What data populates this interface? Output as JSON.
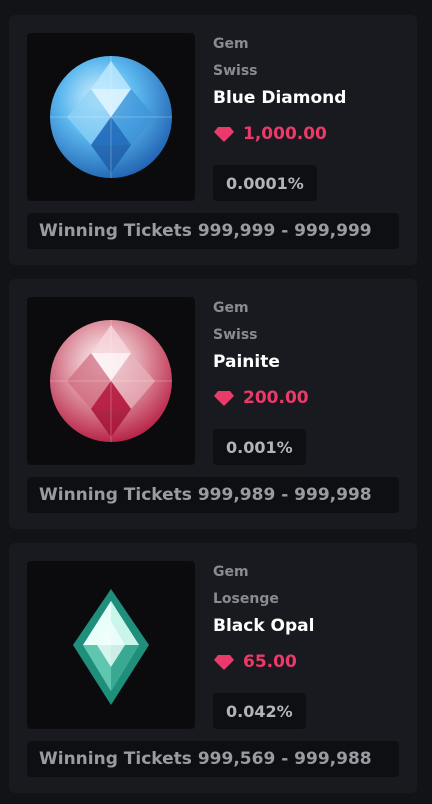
{
  "prizes": [
    {
      "type": "Gem",
      "cut": "Swiss",
      "name": "Blue Diamond",
      "price": "1,000.00",
      "chance": "0.0001%",
      "tickets": "Winning Tickets 999,999 - 999,999",
      "icon": "blue-diamond-gem-icon"
    },
    {
      "type": "Gem",
      "cut": "Swiss",
      "name": "Painite",
      "price": "200.00",
      "chance": "0.001%",
      "tickets": "Winning Tickets 999,989 - 999,998",
      "icon": "painite-gem-icon"
    },
    {
      "type": "Gem",
      "cut": "Losenge",
      "name": "Black Opal",
      "price": "65.00",
      "chance": "0.042%",
      "tickets": "Winning Tickets 999,569 - 999,988",
      "icon": "black-opal-gem-icon"
    }
  ],
  "colors": {
    "background": "#121317",
    "card": "#191a1f",
    "price_accent": "#ea3a6a"
  }
}
